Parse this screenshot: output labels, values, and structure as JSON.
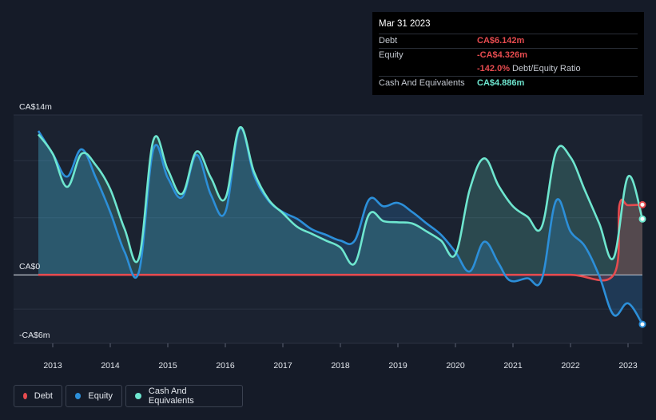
{
  "tooltip": {
    "date": "Mar 31 2023",
    "debt_label": "Debt",
    "debt_value": "CA$6.142m",
    "equity_label": "Equity",
    "equity_value": "-CA$4.326m",
    "ratio_value": "-142.0%",
    "ratio_label": "Debt/Equity Ratio",
    "cash_label": "Cash And Equivalents",
    "cash_value": "CA$4.886m"
  },
  "legend": {
    "debt": "Debt",
    "equity": "Equity",
    "cash": "Cash And Equivalents"
  },
  "colors": {
    "debt": "#e64b4f",
    "equity": "#2c8fd9",
    "cash": "#6ee6cf",
    "background": "#151b28"
  },
  "chart_data": {
    "type": "area",
    "y_tick_labels": [
      "CA$14m",
      "CA$0",
      "-CA$6m"
    ],
    "y_ticks": [
      14,
      0,
      -6
    ],
    "ylim": [
      -6,
      14
    ],
    "x_tick_labels": [
      "2013",
      "2014",
      "2015",
      "2016",
      "2017",
      "2018",
      "2019",
      "2020",
      "2021",
      "2022",
      "2023"
    ],
    "x_ticks": [
      2013,
      2014,
      2015,
      2016,
      2017,
      2018,
      2019,
      2020,
      2021,
      2022,
      2023
    ],
    "xlim": [
      2012.75,
      2023.25
    ],
    "series": [
      {
        "name": "Debt",
        "points": [
          [
            2012.75,
            0
          ],
          [
            2013.0,
            0
          ],
          [
            2014.0,
            0
          ],
          [
            2015.0,
            0
          ],
          [
            2016.0,
            0
          ],
          [
            2017.0,
            0
          ],
          [
            2018.0,
            0
          ],
          [
            2019.0,
            0
          ],
          [
            2020.0,
            0
          ],
          [
            2021.0,
            0
          ],
          [
            2022.0,
            0
          ],
          [
            2022.75,
            0
          ],
          [
            2022.85,
            6.1
          ],
          [
            2023.0,
            6.1
          ],
          [
            2023.25,
            6.14
          ]
        ]
      },
      {
        "name": "Equity",
        "points": [
          [
            2012.75,
            12.6
          ],
          [
            2013.0,
            10.6
          ],
          [
            2013.25,
            8.6
          ],
          [
            2013.5,
            11.0
          ],
          [
            2013.75,
            8.5
          ],
          [
            2014.0,
            5.5
          ],
          [
            2014.25,
            2.0
          ],
          [
            2014.5,
            0.3
          ],
          [
            2014.75,
            11.0
          ],
          [
            2015.0,
            8.5
          ],
          [
            2015.25,
            6.8
          ],
          [
            2015.5,
            10.5
          ],
          [
            2015.75,
            7.0
          ],
          [
            2016.0,
            5.5
          ],
          [
            2016.25,
            12.8
          ],
          [
            2016.5,
            8.7
          ],
          [
            2016.75,
            6.5
          ],
          [
            2017.0,
            5.5
          ],
          [
            2017.25,
            4.9
          ],
          [
            2017.5,
            4.0
          ],
          [
            2017.75,
            3.5
          ],
          [
            2018.0,
            3.0
          ],
          [
            2018.25,
            3.0
          ],
          [
            2018.5,
            6.6
          ],
          [
            2018.75,
            6.0
          ],
          [
            2019.0,
            6.3
          ],
          [
            2019.25,
            5.5
          ],
          [
            2019.5,
            4.5
          ],
          [
            2019.75,
            3.5
          ],
          [
            2020.0,
            2.0
          ],
          [
            2020.25,
            0.3
          ],
          [
            2020.5,
            2.9
          ],
          [
            2020.75,
            1.0
          ],
          [
            2020.95,
            -0.5
          ],
          [
            2021.25,
            -0.3
          ],
          [
            2021.5,
            -0.4
          ],
          [
            2021.75,
            6.5
          ],
          [
            2022.0,
            3.8
          ],
          [
            2022.25,
            2.5
          ],
          [
            2022.5,
            -0.1
          ],
          [
            2022.75,
            -3.5
          ],
          [
            2023.0,
            -2.5
          ],
          [
            2023.25,
            -4.33
          ]
        ]
      },
      {
        "name": "Cash And Equivalents",
        "points": [
          [
            2012.75,
            12.3
          ],
          [
            2013.0,
            10.6
          ],
          [
            2013.25,
            7.7
          ],
          [
            2013.5,
            10.6
          ],
          [
            2013.75,
            9.6
          ],
          [
            2014.0,
            7.5
          ],
          [
            2014.25,
            4.0
          ],
          [
            2014.5,
            1.5
          ],
          [
            2014.75,
            11.8
          ],
          [
            2015.0,
            9.2
          ],
          [
            2015.25,
            7.1
          ],
          [
            2015.5,
            10.8
          ],
          [
            2015.75,
            8.5
          ],
          [
            2016.0,
            6.7
          ],
          [
            2016.25,
            12.9
          ],
          [
            2016.5,
            9.0
          ],
          [
            2016.75,
            6.6
          ],
          [
            2017.0,
            5.4
          ],
          [
            2017.25,
            4.2
          ],
          [
            2017.5,
            3.6
          ],
          [
            2017.75,
            3.0
          ],
          [
            2018.0,
            2.4
          ],
          [
            2018.25,
            1.0
          ],
          [
            2018.5,
            5.3
          ],
          [
            2018.75,
            4.7
          ],
          [
            2019.0,
            4.6
          ],
          [
            2019.25,
            4.5
          ],
          [
            2019.5,
            3.8
          ],
          [
            2019.75,
            3.0
          ],
          [
            2020.0,
            1.8
          ],
          [
            2020.25,
            7.5
          ],
          [
            2020.5,
            10.2
          ],
          [
            2020.75,
            7.8
          ],
          [
            2021.0,
            6.0
          ],
          [
            2021.25,
            5.1
          ],
          [
            2021.5,
            4.2
          ],
          [
            2021.75,
            10.8
          ],
          [
            2022.0,
            10.3
          ],
          [
            2022.25,
            7.4
          ],
          [
            2022.5,
            4.5
          ],
          [
            2022.75,
            1.5
          ],
          [
            2023.0,
            8.6
          ],
          [
            2023.25,
            4.89
          ]
        ]
      }
    ],
    "grid": true,
    "legend_position": "bottom-left"
  }
}
